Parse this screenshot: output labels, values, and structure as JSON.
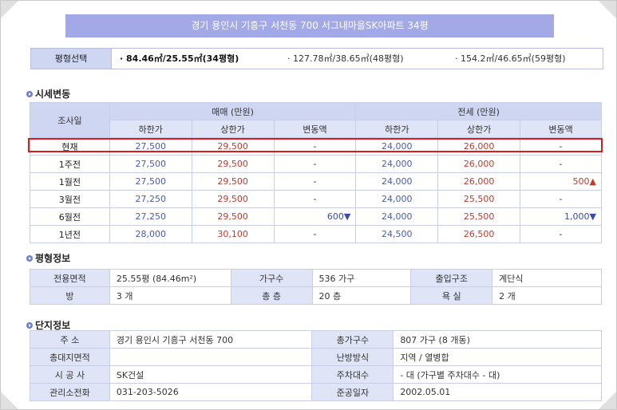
{
  "title": "경기 용인시 기흥구 서천동 700 서그내마을SK아파트 34평",
  "size_select": {
    "label": "평형선택",
    "options": [
      "· 84.46㎡/25.55㎡(34평형)",
      "· 127.78㎡/38.65㎡(48평형)",
      "· 154.2㎡/46.65㎡(59평형)"
    ]
  },
  "price": {
    "section_title": "시세변동",
    "header_date": "조사일",
    "header_sale": "매매 (만원)",
    "header_jeonse": "전세 (만원)",
    "sub": [
      "하한가",
      "상한가",
      "변동액",
      "하한가",
      "상한가",
      "변동액"
    ],
    "rows": [
      {
        "date": "현재",
        "s_low": "27,500",
        "s_high": "29,500",
        "s_chg": "-",
        "j_low": "24,000",
        "j_high": "26,000",
        "j_chg": "-"
      },
      {
        "date": "1주전",
        "s_low": "27,500",
        "s_high": "29,500",
        "s_chg": "-",
        "j_low": "24,000",
        "j_high": "26,000",
        "j_chg": "-"
      },
      {
        "date": "1월전",
        "s_low": "27,500",
        "s_high": "29,500",
        "s_chg": "-",
        "j_low": "24,000",
        "j_high": "26,000",
        "j_chg": "500▲"
      },
      {
        "date": "3월전",
        "s_low": "27,250",
        "s_high": "29,500",
        "s_chg": "-",
        "j_low": "24,000",
        "j_high": "25,500",
        "j_chg": "-"
      },
      {
        "date": "6월전",
        "s_low": "27,250",
        "s_high": "29,500",
        "s_chg": "600▼",
        "j_low": "24,000",
        "j_high": "25,500",
        "j_chg": "1,000▼"
      },
      {
        "date": "1년전",
        "s_low": "28,000",
        "s_high": "30,100",
        "s_chg": "-",
        "j_low": "24,500",
        "j_high": "26,500",
        "j_chg": "-"
      }
    ]
  },
  "pyeong": {
    "section_title": "평형정보",
    "r1": [
      "전용면적",
      "25.55평 (84.46m²)",
      "가구수",
      "536 가구",
      "출입구조",
      "계단식"
    ],
    "r2": [
      "방",
      "3 개",
      "총 층",
      "20 층",
      "욕 실",
      "2 개"
    ]
  },
  "danji": {
    "section_title": "단지정보",
    "rows": [
      [
        "주 소",
        "경기 용인시 기흥구 서천동 700",
        "총가구수",
        "807 가구 (8 개동)"
      ],
      [
        "총대지면적",
        "",
        "난방방식",
        "지역 / 열병합"
      ],
      [
        "시 공 사",
        "SK건설",
        "주차대수",
        "- 대 (가구별 주차대수 - 대)"
      ],
      [
        "관리소전화",
        "031-203-5026",
        "준공일자",
        "2002.05.01"
      ]
    ]
  }
}
